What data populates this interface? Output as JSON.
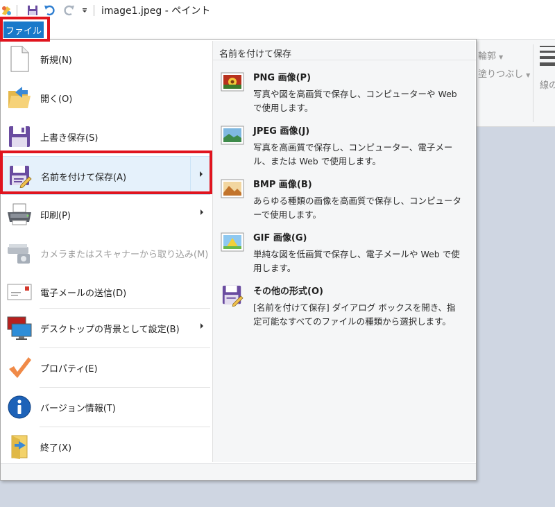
{
  "titlebar": {
    "title": "image1.jpeg - ペイント"
  },
  "ribbon": {
    "file_tab": "ファイル",
    "outline_label": "輪郭",
    "fill_label": "塗りつぶし",
    "line_width_label": "線の"
  },
  "menu": {
    "items": [
      {
        "label": "新規(N)",
        "icon": "new-document-icon"
      },
      {
        "label": "開く(O)",
        "icon": "open-folder-icon"
      },
      {
        "label": "上書き保存(S)",
        "icon": "save-disk-icon"
      },
      {
        "label": "名前を付けて保存(A)",
        "icon": "save-as-icon"
      },
      {
        "label": "印刷(P)",
        "icon": "printer-icon"
      },
      {
        "label": "カメラまたはスキャナーから取り込み(M)",
        "icon": "scanner-icon"
      },
      {
        "label": "電子メールの送信(D)",
        "icon": "email-icon"
      },
      {
        "label": "デスクトップの背景として設定(B)",
        "icon": "desktop-background-icon"
      },
      {
        "label": "プロパティ(E)",
        "icon": "checkmark-icon"
      },
      {
        "label": "バージョン情報(T)",
        "icon": "info-icon"
      },
      {
        "label": "終了(X)",
        "icon": "exit-icon"
      }
    ]
  },
  "submenu": {
    "title": "名前を付けて保存",
    "items": [
      {
        "title": "PNG 画像(P)",
        "desc": "写真や図を高画質で保存し、コンピューターや Web で使用します。",
        "icon": "png-image-icon"
      },
      {
        "title": "JPEG 画像(J)",
        "desc": "写真を高画質で保存し、コンピューター、電子メール、または Web で使用します。",
        "icon": "jpeg-image-icon"
      },
      {
        "title": "BMP 画像(B)",
        "desc": "あらゆる種類の画像を高画質で保存し、コンピューターで使用します。",
        "icon": "bmp-image-icon"
      },
      {
        "title": "GIF 画像(G)",
        "desc": "単純な図を低画質で保存し、電子メールや Web で使用します。",
        "icon": "gif-image-icon"
      },
      {
        "title": "その他の形式(O)",
        "desc": "[名前を付けて保存] ダイアログ ボックスを開き、指定可能なすべてのファイルの種類から選択します。",
        "icon": "other-formats-icon"
      }
    ]
  },
  "colors": {
    "accent": "#1979ca",
    "highlight_frame": "#e0141e",
    "selected_bg": "#e5f1fb"
  }
}
